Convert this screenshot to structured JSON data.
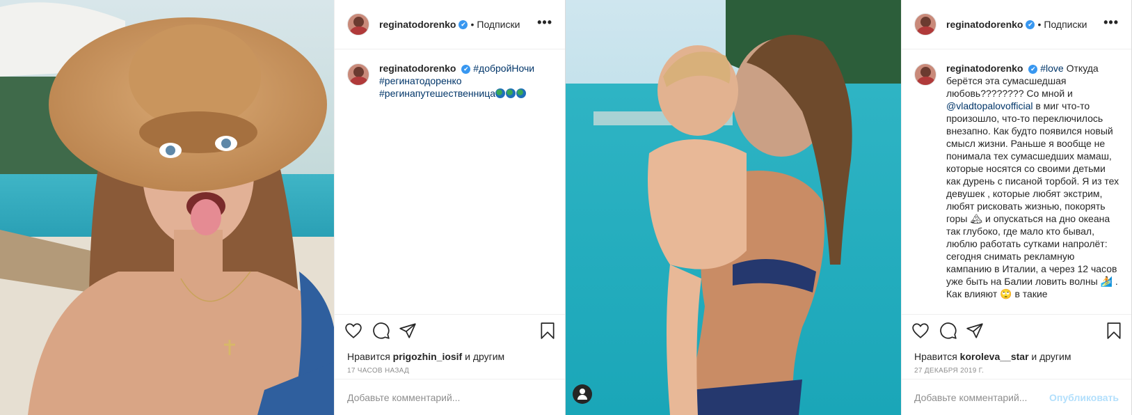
{
  "posts": [
    {
      "username": "reginatodorenko",
      "verified_mark": "✔",
      "separator": "•",
      "follow_label": "Подписки",
      "more_label": "•••",
      "caption_parts": {
        "hashtag1": "#добройНочи",
        "hashtag2": "#регинатодоренко",
        "hashtag3": "#регинапутешественница"
      },
      "likes_prefix": "Нравится",
      "likes_user": "prigozhin_iosif",
      "likes_suffix": "и другим",
      "date": "17 ЧАСОВ НАЗАД",
      "comment_placeholder": "Добавьте комментарий...",
      "post_label": ""
    },
    {
      "username": "reginatodorenko",
      "verified_mark": "✔",
      "separator": "•",
      "follow_label": "Подписки",
      "more_label": "•••",
      "caption_parts": {
        "hashtag": "#love",
        "text1": "Откуда берётся эта сумасшедшая любовь???????? Со мной и",
        "mention": "@vladtopalovofficial",
        "text2": "в миг что-то произошло, что-то переключилось внезапно. Как будто появился новый смысл жизни. Раньше я вообще не понимала тех сумасшедших мамаш, которые носятся со своими детьми как дурень с писаной торбой. Я из тех девушек , которые любят экстрим, любят рисковать жизнью, покорять горы 🏔 и опускаться на дно океана так глубоко, где мало кто бывал, люблю работать сутками напролёт: сегодня снимать рекламную кампанию в Италии, а через 12 часов уже быть на Балии ловить волны 🏄 . Как влияют 🙄 в такие"
      },
      "likes_prefix": "Нравится",
      "likes_user": "koroleva__star",
      "likes_suffix": "и другим",
      "date": "27 ДЕКАБРЯ 2019 Г.",
      "comment_placeholder": "Добавьте комментарий...",
      "post_label": "Опубликовать"
    }
  ],
  "icons": {
    "like": "heart-icon",
    "comment": "comment-icon",
    "share": "share-icon",
    "save": "bookmark-icon",
    "tag": "user-tag-icon"
  },
  "colors": {
    "link": "#003569",
    "verified": "#3897f0",
    "muted": "#8e8e8e",
    "post_button": "#b2dffc"
  }
}
